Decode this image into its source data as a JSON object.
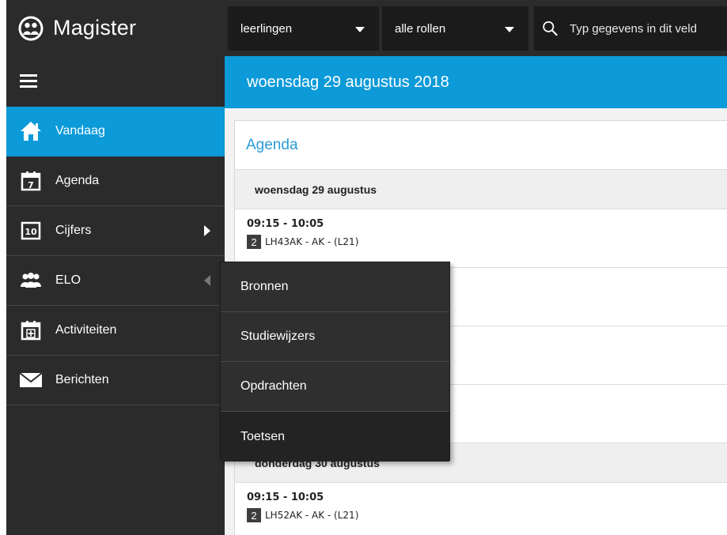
{
  "brand": {
    "name": "Magister",
    "logo_icon": "magister-logo-icon"
  },
  "topbar": {
    "dropdown1": "leerlingen",
    "dropdown2": "alle rollen",
    "search_placeholder": "Typ gegevens in dit veld"
  },
  "sidebar": {
    "items": [
      {
        "label": "Vandaag",
        "icon": "home-icon",
        "active": true
      },
      {
        "label": "Agenda",
        "icon": "calendar-icon"
      },
      {
        "label": "Cijfers",
        "icon": "grades-icon",
        "arrow": "right"
      },
      {
        "label": "ELO",
        "icon": "people-icon",
        "arrow": "left"
      },
      {
        "label": "Activiteiten",
        "icon": "calendar-add-icon"
      },
      {
        "label": "Berichten",
        "icon": "envelope-icon"
      }
    ],
    "cijfers_badge": "10",
    "agenda_badge": "7"
  },
  "datebar": {
    "date": "woensdag 29 augustus 2018"
  },
  "panel": {
    "title": "Agenda",
    "day1": "woensdag 29 augustus",
    "lesson1": {
      "time": "09:15 - 10:05",
      "num": "2",
      "desc": "LH43AK - AK - (L21)"
    },
    "day2": "donderdag 30 augustus",
    "lesson2": {
      "time": "09:15 - 10:05",
      "num": "2",
      "desc": "LH52AK - AK - (L21)"
    }
  },
  "submenu": {
    "items": [
      "Bronnen",
      "Studiewijzers",
      "Opdrachten",
      "Toetsen"
    ]
  },
  "colors": {
    "accent": "#0c9ad8",
    "sidebar": "#2b2b2b",
    "title": "#2a9bd6"
  }
}
